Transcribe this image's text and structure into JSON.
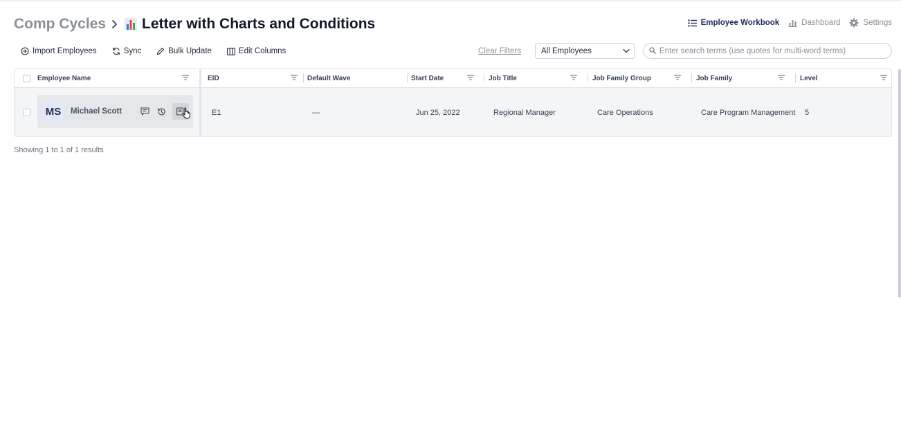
{
  "breadcrumb": {
    "parent": "Comp Cycles",
    "title_icon": "bar-chart-emoji",
    "title": "Letter with Charts and Conditions"
  },
  "nav": {
    "items": [
      {
        "label": "Employee Workbook",
        "icon": "list-icon",
        "active": true
      },
      {
        "label": "Dashboard",
        "icon": "bar-chart-icon",
        "active": false
      },
      {
        "label": "Settings",
        "icon": "gear-icon",
        "active": false
      }
    ]
  },
  "toolbar": {
    "import_label": "Import Employees",
    "sync_label": "Sync",
    "bulk_update_label": "Bulk Update",
    "edit_columns_label": "Edit Columns",
    "clear_filters_label": "Clear Filters",
    "employee_filter_value": "All Employees",
    "search_placeholder": "Enter search terms (use quotes for multi-word terms)"
  },
  "table": {
    "columns": [
      "Employee Name",
      "EID",
      "Default Wave",
      "Start Date",
      "Job Title",
      "Job Family Group",
      "Job Family",
      "Level"
    ],
    "rows": [
      {
        "initials": "MS",
        "name": "Michael Scott",
        "eid": "E1",
        "default_wave": "—",
        "start_date": "Jun 25, 2022",
        "job_title": "Regional Manager",
        "job_family_group": "Care Operations",
        "job_family": "Care Program Management",
        "level": "5"
      }
    ]
  },
  "footer": {
    "results_text": "Showing 1 to 1 of 1 results"
  },
  "colors": {
    "accent_navy": "#1e2a5a",
    "muted_text": "#8a8f98",
    "row_bg": "#f4f5f7"
  }
}
